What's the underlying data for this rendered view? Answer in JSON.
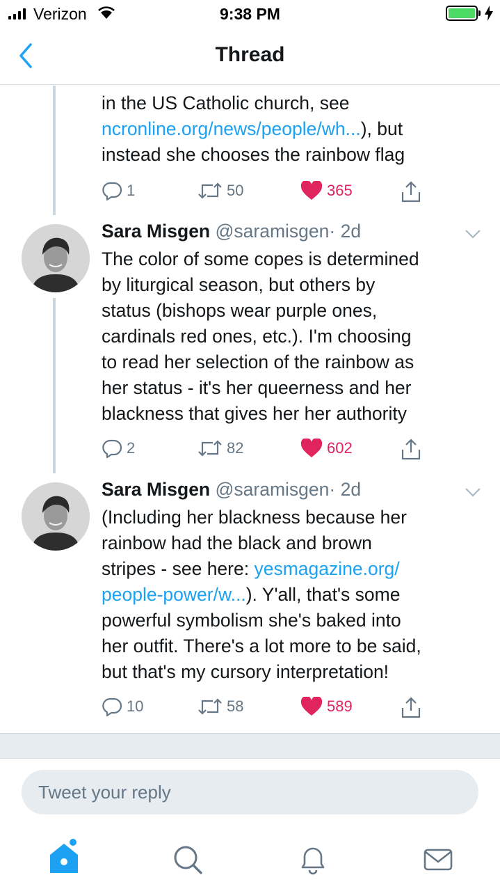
{
  "status_bar": {
    "carrier": "Verizon",
    "time": "9:38 PM",
    "battery_level": 1.0
  },
  "nav": {
    "title": "Thread",
    "back_icon": "chevron-left-icon"
  },
  "tweets": [
    {
      "text_lines": [
        {
          "parts": [
            {
              "t": "in the US Catholic church, see",
              "link": false
            }
          ]
        },
        {
          "parts": [
            {
              "t": "ncronline.org/news/people/wh...",
              "link": true
            },
            {
              "t": "), but",
              "link": false
            }
          ]
        },
        {
          "parts": [
            {
              "t": "instead she chooses the rainbow flag",
              "link": false
            }
          ]
        }
      ],
      "actions": {
        "replies": "1",
        "retweets": "50",
        "likes": "365"
      }
    },
    {
      "name": "Sara Misgen",
      "handle": "@saramisgen",
      "time": "· 2d",
      "text_lines": [
        {
          "parts": [
            {
              "t": "The color of some copes is determined",
              "link": false
            }
          ]
        },
        {
          "parts": [
            {
              "t": "by liturgical season, but others by",
              "link": false
            }
          ]
        },
        {
          "parts": [
            {
              "t": "status (bishops wear purple ones,",
              "link": false
            }
          ]
        },
        {
          "parts": [
            {
              "t": "cardinals red ones, etc.). I'm choosing",
              "link": false
            }
          ]
        },
        {
          "parts": [
            {
              "t": "to read her selection of the rainbow as",
              "link": false
            }
          ]
        },
        {
          "parts": [
            {
              "t": "her status - it's her queerness and her",
              "link": false
            }
          ]
        },
        {
          "parts": [
            {
              "t": "blackness that gives her her authority",
              "link": false
            }
          ]
        }
      ],
      "actions": {
        "replies": "2",
        "retweets": "82",
        "likes": "602"
      }
    },
    {
      "name": "Sara Misgen",
      "handle": "@saramisgen",
      "time": "· 2d",
      "text_lines": [
        {
          "parts": [
            {
              "t": "(Including her blackness because her",
              "link": false
            }
          ]
        },
        {
          "parts": [
            {
              "t": "rainbow had the black and brown",
              "link": false
            }
          ]
        },
        {
          "parts": [
            {
              "t": "stripes - see here: ",
              "link": false
            },
            {
              "t": "yesmagazine.org/",
              "link": true
            }
          ]
        },
        {
          "parts": [
            {
              "t": "people-power/w...",
              "link": true
            },
            {
              "t": "). Y'all, that's some",
              "link": false
            }
          ]
        },
        {
          "parts": [
            {
              "t": "powerful symbolism she's baked into",
              "link": false
            }
          ]
        },
        {
          "parts": [
            {
              "t": "her outfit. There's a lot more to be said,",
              "link": false
            }
          ]
        },
        {
          "parts": [
            {
              "t": "but that's my cursory interpretation!",
              "link": false
            }
          ]
        }
      ],
      "actions": {
        "replies": "10",
        "retweets": "58",
        "likes": "589"
      }
    }
  ],
  "reply": {
    "placeholder": "Tweet your reply"
  },
  "tabs": [
    {
      "icon": "home-icon",
      "active": true,
      "has_dot": true
    },
    {
      "icon": "search-icon",
      "active": false
    },
    {
      "icon": "bell-icon",
      "active": false
    },
    {
      "icon": "mail-icon",
      "active": false
    }
  ],
  "colors": {
    "accent": "#1da1f2",
    "like": "#e0245e",
    "secondary_text": "#657786",
    "battery": "#4cd964"
  }
}
